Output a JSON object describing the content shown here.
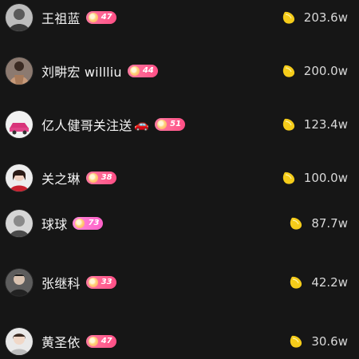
{
  "colors": {
    "background": "#161616",
    "bean": "#f5cc1a",
    "badge_red": "#ff5a8c",
    "badge_pink": "#ff6fcf"
  },
  "ranking": [
    {
      "name": "王祖蓝",
      "level": "47",
      "badge_style": "red",
      "amount": "203.6w",
      "avatar_icon": "avatar-portrait"
    },
    {
      "name": "刘畊宏 willliu",
      "level": "44",
      "badge_style": "red",
      "amount": "200.0w",
      "avatar_icon": "avatar-portrait"
    },
    {
      "name": "亿人健哥关注送",
      "emoji": "🚗",
      "level": "51",
      "badge_style": "red",
      "amount": "123.4w",
      "avatar_icon": "avatar-car"
    },
    {
      "name": "关之琳",
      "level": "38",
      "badge_style": "red",
      "amount": "100.0w",
      "avatar_icon": "avatar-portrait"
    },
    {
      "name": "球球",
      "level": "73",
      "badge_style": "pink",
      "amount": "87.7w",
      "avatar_icon": "avatar-portrait"
    },
    {
      "name": "张继科",
      "level": "33",
      "badge_style": "red",
      "amount": "42.2w",
      "avatar_icon": "avatar-portrait"
    },
    {
      "name": "黄圣依",
      "level": "47",
      "badge_style": "red",
      "amount": "30.6w",
      "avatar_icon": "avatar-portrait"
    }
  ]
}
